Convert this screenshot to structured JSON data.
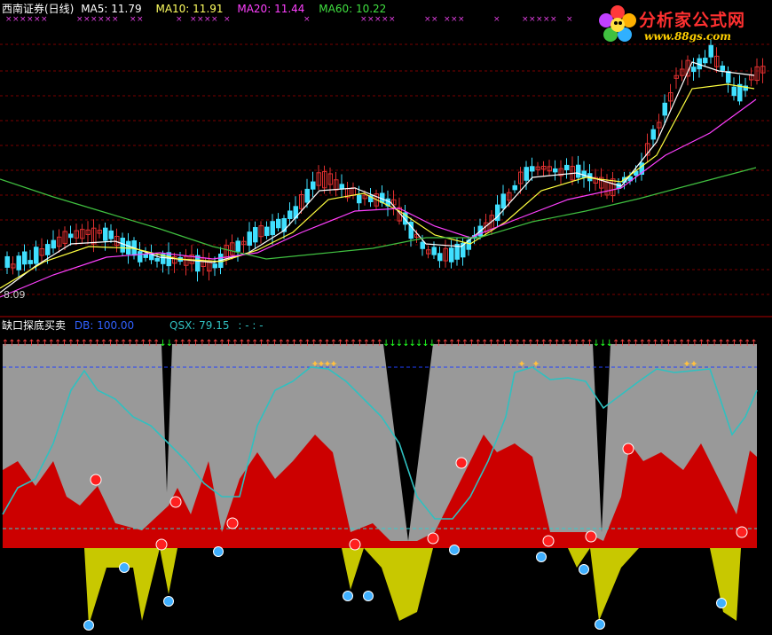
{
  "header": {
    "title": "西南证券(日线)",
    "ma5_label": "MA5:",
    "ma5_value": "11.79",
    "ma10_label": "MA10:",
    "ma10_value": "11.91",
    "ma20_label": "MA20:",
    "ma20_value": "11.44",
    "ma60_label": "MA60:",
    "ma60_value": "10.22"
  },
  "main_chart": {
    "low_label": "8.09"
  },
  "indicator": {
    "title": "缺口探底买卖",
    "db_label": "DB:",
    "db_value": "100.00",
    "qsx_label": "QSX:",
    "qsx_value": "79.15",
    "extra": ": - : -"
  },
  "watermark": {
    "site_name": "分析家公式网",
    "site_url": "www.88gs.com"
  },
  "colors": {
    "background": "#000000",
    "grid": "#7a0000",
    "up_candle": "#e03030",
    "down_candle": "#40e0ff",
    "ma5": "#ffffff",
    "ma10": "#ffff40",
    "ma20": "#ff40ff",
    "ma60": "#40c040",
    "indicator_gray": "#999999",
    "indicator_red": "#cc0000",
    "indicator_yellow": "#c8c800",
    "qsx_line": "#30c0c0"
  },
  "icons": [
    "cross-marker-icon",
    "red-ball-icon",
    "blue-ball-icon",
    "up-arrow-icon",
    "down-arrow-icon",
    "runner-icon",
    "flower-logo-icon"
  ]
}
